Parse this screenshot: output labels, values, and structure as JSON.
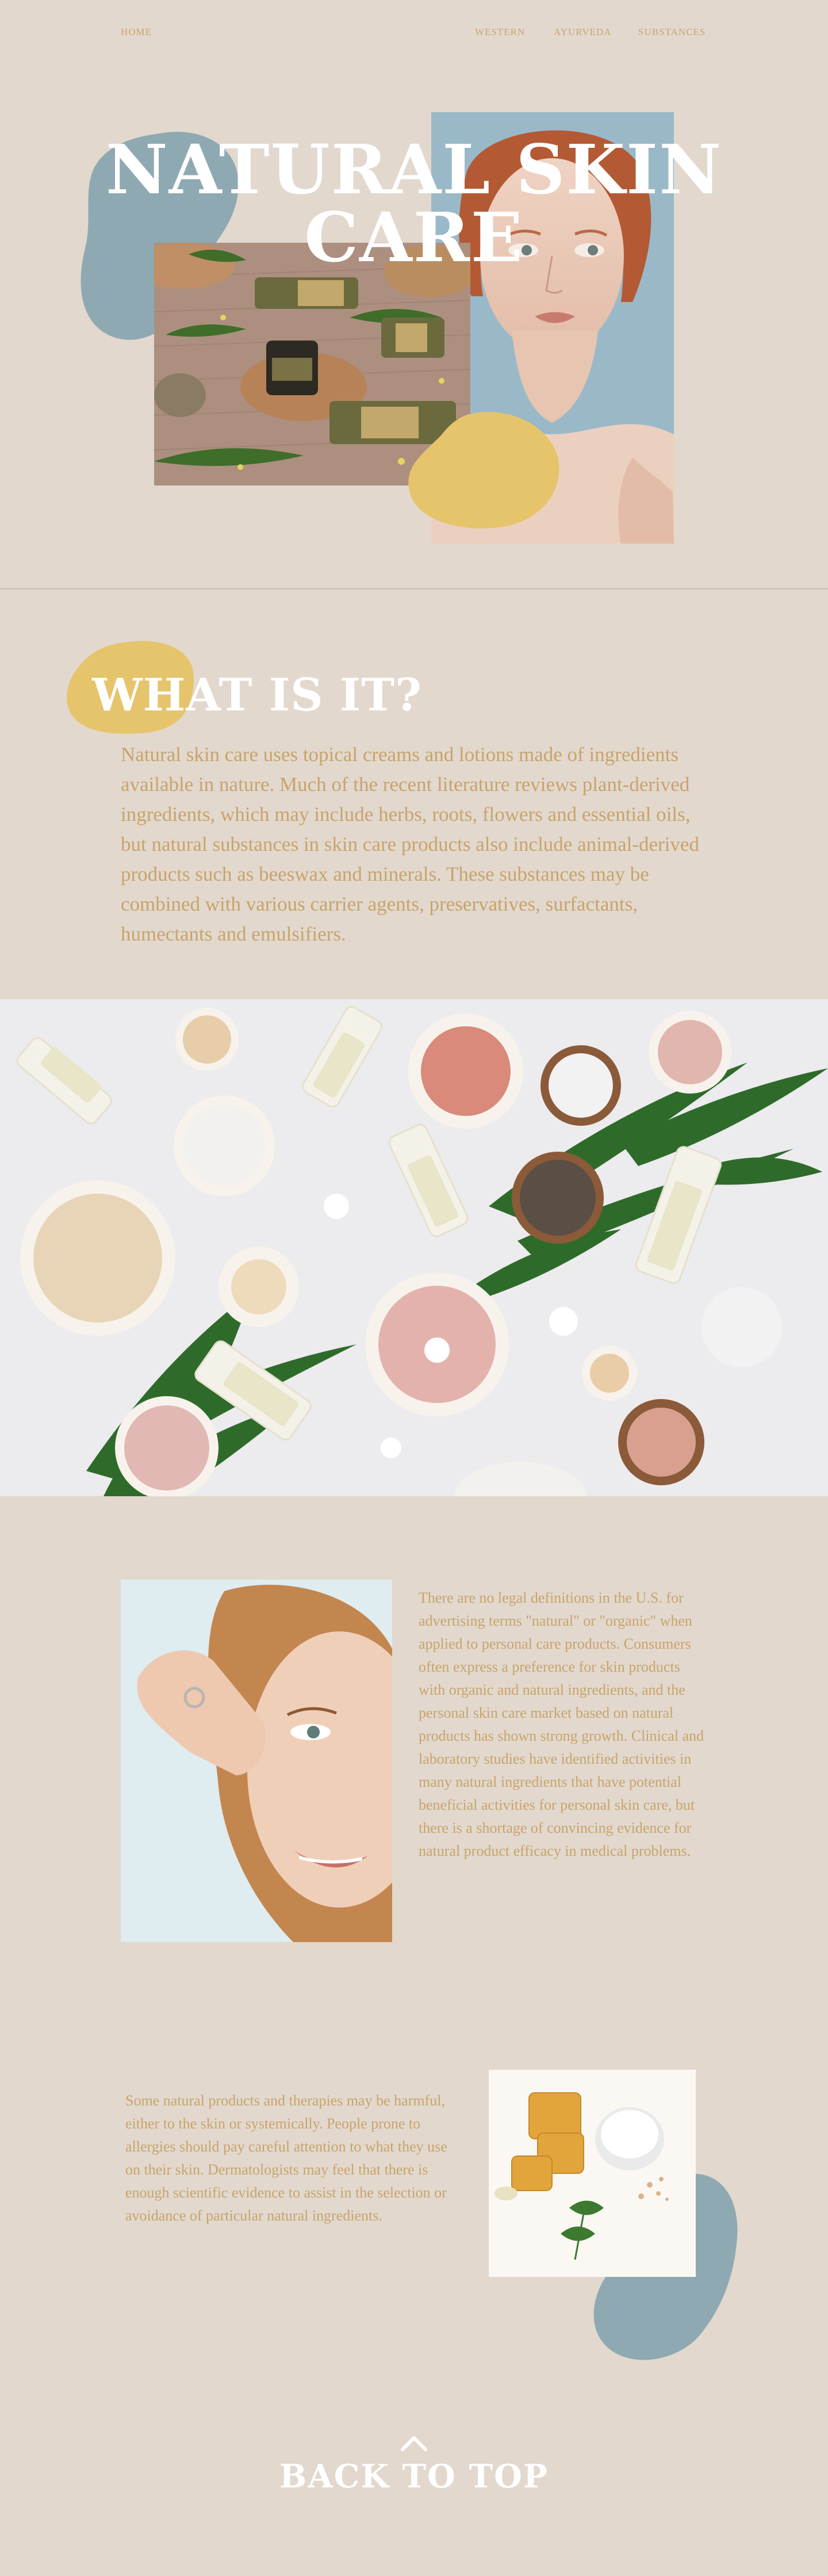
{
  "nav": {
    "home": "HOME",
    "western": "WESTERN",
    "ayurveda": "AYURVEDA",
    "substances": "SUBSTANCES"
  },
  "hero": {
    "title": "NATURAL SKIN CARE",
    "images": [
      "skincare-jars-herbs-photo",
      "woman-portrait-photo"
    ]
  },
  "what_is_it": {
    "title": "WHAT IS IT?",
    "text": "Natural skin care uses topical creams and lotions made of ingredients available in nature. Much of the recent literature reviews plant-derived ingredients, which may include herbs, roots, flowers and essential oils, but natural substances in skin care products also include animal-derived products such as beeswax and minerals. These substances may be combined with various carrier agents, preservatives, surfactants, humectants and emulsifiers."
  },
  "section_legal": {
    "text": "There are no legal definitions in the U.S. for advertising terms \"natural\" or \"organic\" when applied to personal care products. Consumers often express a preference for skin products with organic and natural ingredients, and the personal skin care market based on natural products has shown strong growth. Clinical and laboratory studies have identified activities in many natural ingredients that have potential beneficial activities for personal skin care, but there is a shortage of convincing evidence for natural product efficacy in medical problems."
  },
  "section_harm": {
    "text": "Some natural products and therapies may be harmful, either to the skin or systemically. People prone to allergies should pay careful attention to what they use on their skin. Dermatologists may feel that there is enough scientific evidence to assist in the selection or avoidance of particular natural ingredients."
  },
  "footer": {
    "back_to_top": "BACK TO TOP"
  },
  "colors": {
    "background": "#e2d8ce",
    "accent_gold": "#c8a46a",
    "blob_blue": "#8fa9b2",
    "blob_yellow": "#e6c46c"
  }
}
